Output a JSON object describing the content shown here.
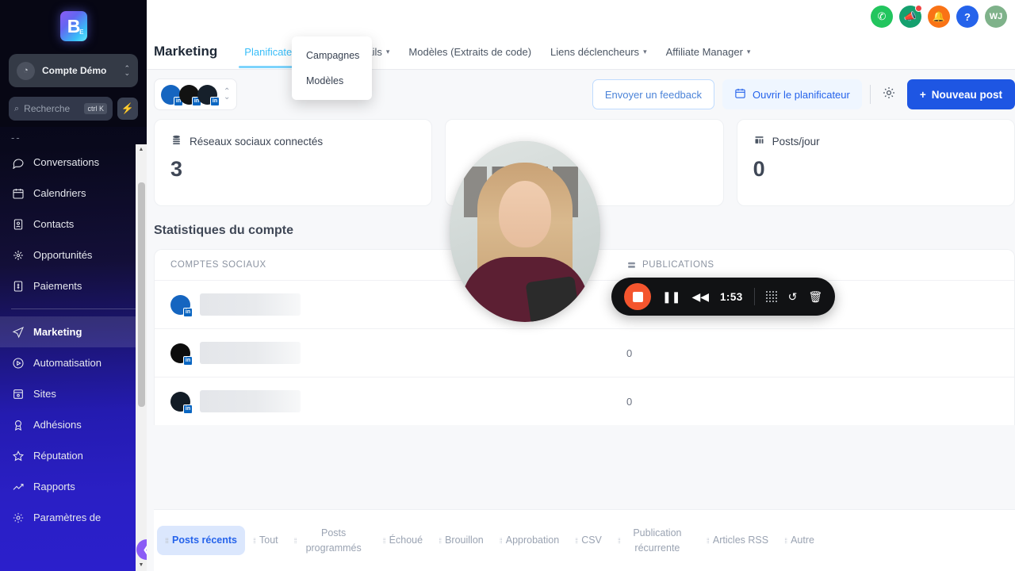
{
  "sidebar": {
    "logo": "B",
    "logo_sub": "E",
    "account": {
      "name": "Compte Démo",
      "icon": "cursor-icon"
    },
    "search": {
      "placeholder": "Recherche",
      "shortcut": "ctrl K",
      "bolt_icon": "bolt-icon"
    },
    "dots": "--",
    "items": [
      {
        "label": "Conversations",
        "icon": "chat-icon",
        "active": false
      },
      {
        "label": "Calendriers",
        "icon": "calendar-icon",
        "active": false
      },
      {
        "label": "Contacts",
        "icon": "contacts-icon",
        "active": false
      },
      {
        "label": "Opportunités",
        "icon": "opportunities-icon",
        "active": false
      },
      {
        "label": "Paiements",
        "icon": "payments-icon",
        "active": false
      },
      {
        "label": "Marketing",
        "icon": "send-icon",
        "active": true
      },
      {
        "label": "Automatisation",
        "icon": "play-circle-icon",
        "active": false
      },
      {
        "label": "Sites",
        "icon": "sites-icon",
        "active": false
      },
      {
        "label": "Adhésions",
        "icon": "badge-icon",
        "active": false
      },
      {
        "label": "Réputation",
        "icon": "star-icon",
        "active": false
      },
      {
        "label": "Rapports",
        "icon": "trend-icon",
        "active": false
      },
      {
        "label": "Paramètres de",
        "icon": "gear-icon",
        "active": false
      }
    ],
    "collapse_icon": "chevron-left-icon"
  },
  "topbar": {
    "icons": [
      {
        "name": "phone-icon",
        "glyph": "✆",
        "color": "#22c55e"
      },
      {
        "name": "announcement-icon",
        "glyph": "📣",
        "color": "#15a06e",
        "badge": true
      },
      {
        "name": "bell-icon",
        "glyph": "🔔",
        "color": "#f97316"
      },
      {
        "name": "help-icon",
        "glyph": "?",
        "color": "#2563eb"
      }
    ],
    "avatar_initials": "WJ"
  },
  "navbar": {
    "title": "Marketing",
    "tabs": [
      {
        "label": "Planificateur Social",
        "caret": false,
        "active": true
      },
      {
        "label": "Emails",
        "caret": true,
        "active": false
      },
      {
        "label": "Modèles (Extraits de code)",
        "caret": false,
        "active": false
      },
      {
        "label": "Liens déclencheurs",
        "caret": true,
        "active": false
      },
      {
        "label": "Affiliate Manager",
        "caret": true,
        "active": false
      }
    ]
  },
  "dropdown": {
    "items": [
      {
        "label": "Campagnes"
      },
      {
        "label": "Modèles"
      }
    ]
  },
  "toolbar": {
    "feedback_label": "Envoyer un feedback",
    "planner_label": "Ouvrir le planificateur",
    "planner_icon": "calendar-icon",
    "settings_icon": "gear-icon",
    "new_post_label": "Nouveau post",
    "new_post_icon": "plus-icon",
    "avatar_count": 3,
    "avatar_badge": "in"
  },
  "cards": [
    {
      "title": "Réseaux sociaux connectés",
      "value": "3",
      "icon": "database-icon"
    },
    {
      "title": "",
      "value": "",
      "icon": ""
    },
    {
      "title": "Posts/jour",
      "value": "0",
      "icon": "chart-icon"
    }
  ],
  "stats": {
    "section_title": "Statistiques du compte",
    "columns": [
      {
        "label": "COMPTES SOCIAUX",
        "icon": ""
      },
      {
        "label": "PUBLICATIONS",
        "icon": "list-icon"
      }
    ],
    "rows": [
      {
        "account": "",
        "badge": "in",
        "publications": "0"
      },
      {
        "account": "",
        "badge": "in",
        "publications": "0"
      },
      {
        "account": "",
        "badge": "in",
        "publications": "0"
      }
    ]
  },
  "footer_tabs": [
    {
      "label": "Posts récents",
      "active": true
    },
    {
      "label": "Tout",
      "active": false
    },
    {
      "label": "Posts programmés",
      "active": false
    },
    {
      "label": "Échoué",
      "active": false
    },
    {
      "label": "Brouillon",
      "active": false
    },
    {
      "label": "Approbation",
      "active": false
    },
    {
      "label": "CSV",
      "active": false
    },
    {
      "label": "Publication récurrente",
      "active": false
    },
    {
      "label": "Articles RSS",
      "active": false
    },
    {
      "label": "Autre",
      "active": false
    }
  ],
  "recorder": {
    "time": "1:53",
    "stop_icon": "stop-icon",
    "pause_icon": "pause-icon",
    "rewind_icon": "rewind-icon",
    "drag_icon": "drag-handle-icon",
    "restart_icon": "restart-icon",
    "delete_icon": "trash-icon"
  },
  "colors": {
    "accent": "#1e56e3",
    "active_tab": "#38bdf8",
    "record": "#f4552e"
  }
}
